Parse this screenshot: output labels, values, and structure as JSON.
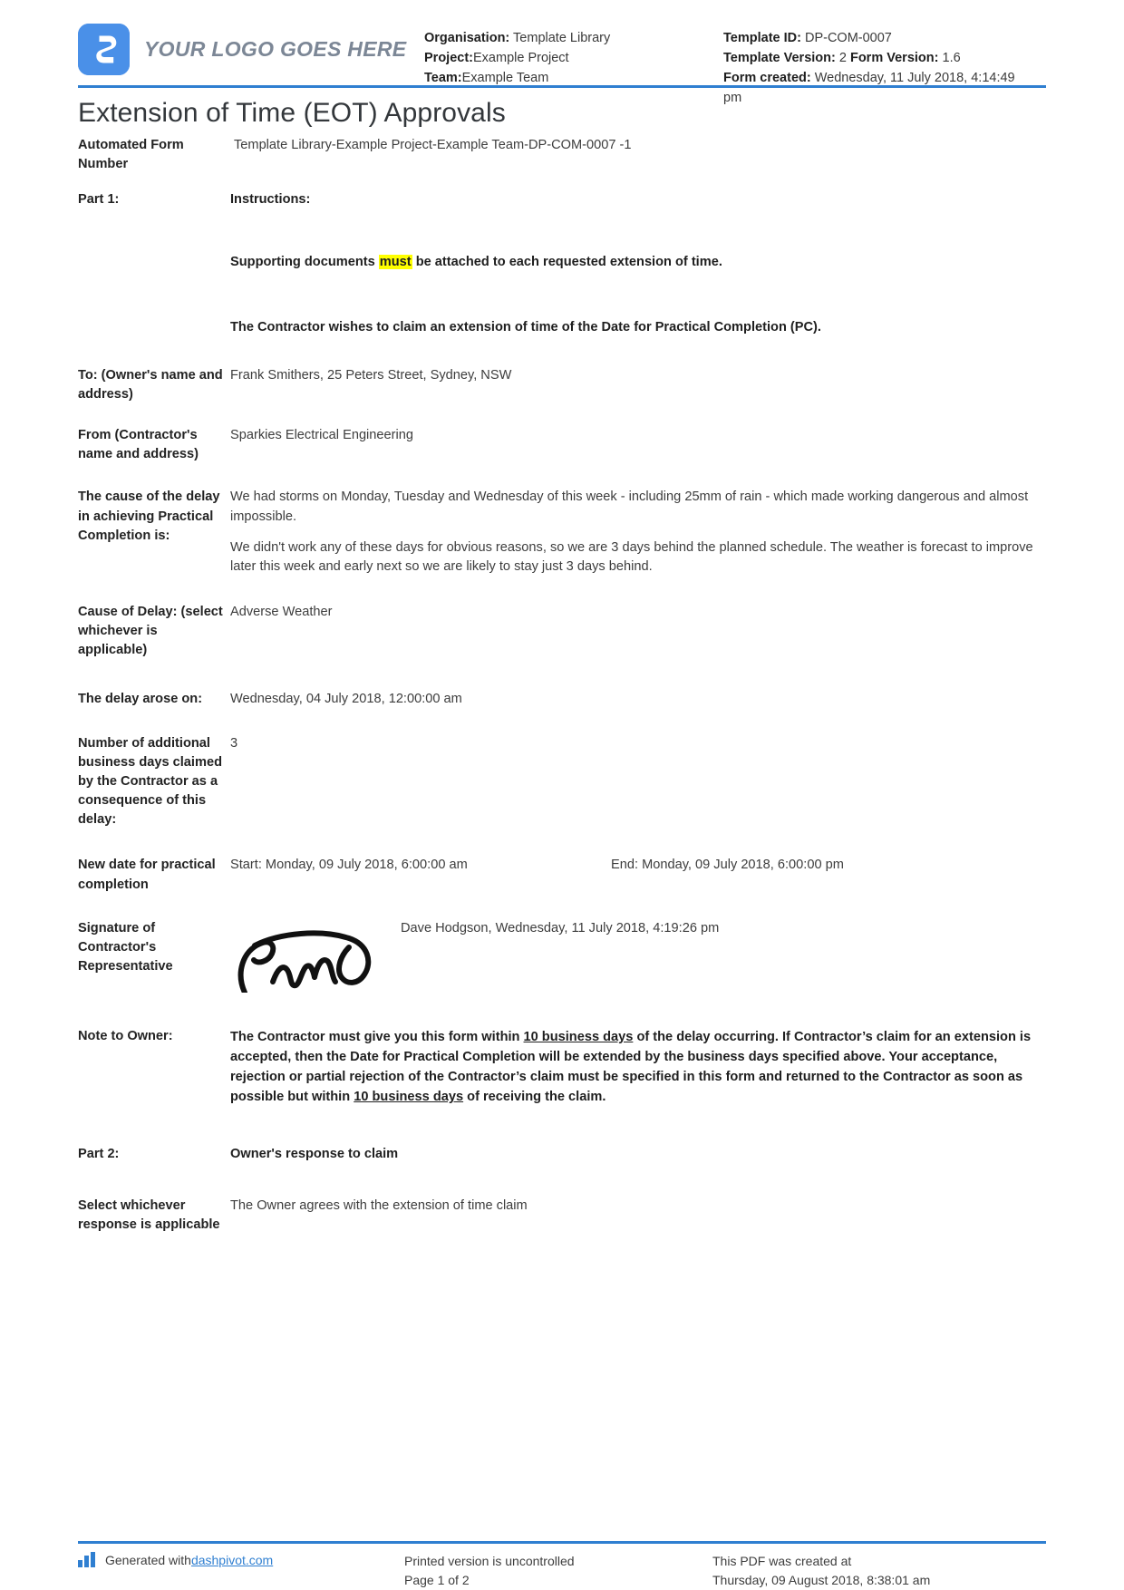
{
  "header": {
    "logo_text": "YOUR LOGO GOES HERE",
    "logo_icon": "dashpivot-logo-icon",
    "accent_color": "#4a90e8",
    "rule_color": "#2f7fd1",
    "meta_left": [
      {
        "label": "Organisation:",
        "value": "Template Library"
      },
      {
        "label": "Project:",
        "value": "Example Project"
      },
      {
        "label": "Team:",
        "value": "Example Team"
      }
    ],
    "meta_right": {
      "template_id_label": "Template ID:",
      "template_id_value": "DP-COM-0007",
      "template_version_label": "Template Version:",
      "template_version_value": "2",
      "form_version_label": "Form Version:",
      "form_version_value": "1.6",
      "form_created_label": "Form created:",
      "form_created_value": "Wednesday, 11 July 2018, 4:14:49 pm"
    }
  },
  "title": "Extension of Time (EOT) Approvals",
  "fields": {
    "form_number_label": "Automated Form Number",
    "form_number_value": "Template Library-Example Project-Example Team-DP-COM-0007   -1",
    "part1_label": "Part 1:",
    "part1_value": "Instructions:",
    "instruction1_pre": "Supporting documents ",
    "instruction1_highlight": "must",
    "instruction1_post": " be attached to each requested extension of time.",
    "instruction2": "The Contractor wishes to claim an extension of time of the Date for Practical Completion (PC).",
    "to_label": "To: (Owner's name and address)",
    "to_value": "Frank Smithers, 25 Peters Street, Sydney, NSW",
    "from_label": "From (Contractor's name and address)",
    "from_value": "Sparkies Electrical Engineering",
    "cause_label": "The cause of the delay in achieving Practical Completion is:",
    "cause_p1": "We had storms on Monday, Tuesday and Wednesday of this week - including 25mm of rain - which made working dangerous and almost impossible.",
    "cause_p2": "We didn't work any of these days for obvious reasons, so we are 3 days behind the planned schedule. The weather is forecast to improve later this week and early next so we are likely to stay just 3 days behind.",
    "cause_of_delay_label": "Cause of Delay: (select whichever is applicable)",
    "cause_of_delay_value": "Adverse Weather",
    "delay_arose_label": "The delay arose on:",
    "delay_arose_value": "Wednesday, 04 July 2018, 12:00:00 am",
    "days_claimed_label": "Number of additional business days claimed by the Contractor as a consequence of this delay:",
    "days_claimed_value": "3",
    "new_date_label": "New date for practical completion",
    "new_date_start": "Start: Monday, 09 July 2018, 6:00:00 am",
    "new_date_end": "End: Monday, 09 July 2018, 6:00:00 pm",
    "signature_label": "Signature of Contractor's Representative",
    "signature_icon": "handwritten-signature-icon",
    "signature_name": "Dave Hodgson, Wednesday, 11 July 2018, 4:19:26 pm",
    "note_label": "Note to Owner:",
    "note_s1": "The Contractor must give you this form within ",
    "note_u1": "10 business days",
    "note_s2": " of the delay occurring. If Contractor’s claim for an extension is accepted, then the Date for Practical Completion will be extended by the business days specified above. Your acceptance, rejection or partial rejection of the Contractor’s claim must be specified in this form and returned to the Contractor as soon as possible but within ",
    "note_u2": "10 business days",
    "note_s3": " of receiving the claim.",
    "part2_label": "Part 2:",
    "part2_value": "Owner's response to claim",
    "select_label": "Select whichever response is applicable",
    "select_value": "The Owner agrees with the extension of time claim"
  },
  "footer": {
    "generated_prefix": "Generated with ",
    "generated_link": "dashpivot.com",
    "bars_icon": "bar-chart-icon",
    "uncontrolled": "Printed version is uncontrolled",
    "page_number": "Page 1 of 2",
    "created_at_label": "This PDF was created at",
    "created_at_value": "Thursday, 09 August 2018, 8:38:01 am"
  }
}
